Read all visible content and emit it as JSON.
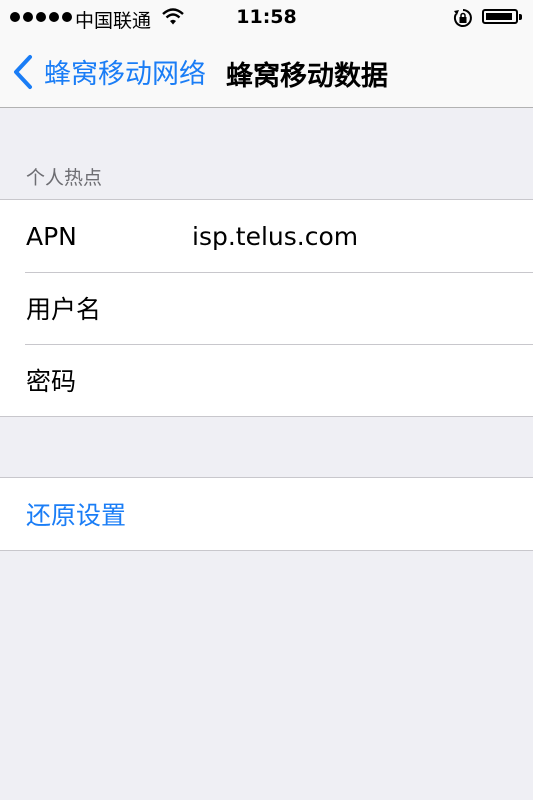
{
  "status_bar": {
    "carrier": "中国联通",
    "time": "11:58"
  },
  "nav": {
    "back_label": "蜂窝移动网络",
    "title": "蜂窝移动数据"
  },
  "hotspot": {
    "header": "个人热点",
    "rows": [
      {
        "label": "APN",
        "value": "isp.telus.com"
      },
      {
        "label": "用户名",
        "value": ""
      },
      {
        "label": "密码",
        "value": ""
      }
    ]
  },
  "reset": {
    "label": "还原设置"
  },
  "colors": {
    "accent": "#1a7df6",
    "background": "#efeff4"
  }
}
